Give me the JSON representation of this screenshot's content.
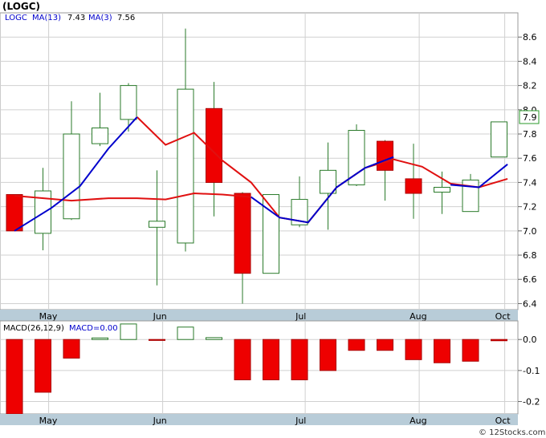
{
  "title": "(LOGC)",
  "watermark": "© 12Stocks.com",
  "chart_data": [
    {
      "type": "candlestick",
      "symbol_label": "LOGC",
      "legend": [
        {
          "label": "MA(13)",
          "value": "7.43",
          "color": "#0000cc"
        },
        {
          "label": "MA(3)",
          "value": "7.56",
          "color": "#0000cc"
        }
      ],
      "last_price_label": "7.9",
      "ylim": [
        6.35,
        8.8
      ],
      "yticks": [
        "6.4",
        "6.6",
        "6.8",
        "7.0",
        "7.2",
        "7.4",
        "7.6",
        "7.8",
        "8.0",
        "8.2",
        "8.4",
        "8.6"
      ],
      "month_labels": [
        {
          "label": "May",
          "index": 1.2
        },
        {
          "label": "Jun",
          "index": 5.2
        },
        {
          "label": "Jul",
          "index": 10.2
        },
        {
          "label": "Aug",
          "index": 14.2
        },
        {
          "label": "Oct",
          "index": 17.2
        }
      ],
      "candles": [
        {
          "open": 7.3,
          "close": 7.0,
          "high": 7.3,
          "low": 7.0,
          "color": "red"
        },
        {
          "open": 6.98,
          "close": 7.33,
          "high": 7.52,
          "low": 6.84,
          "color": "white"
        },
        {
          "open": 7.1,
          "close": 7.8,
          "high": 8.07,
          "low": 7.09,
          "color": "white"
        },
        {
          "open": 7.72,
          "close": 7.85,
          "high": 8.14,
          "low": 7.7,
          "color": "white"
        },
        {
          "open": 7.92,
          "close": 8.2,
          "high": 8.22,
          "low": 7.82,
          "color": "white"
        },
        {
          "open": 7.03,
          "close": 7.08,
          "high": 7.5,
          "low": 6.55,
          "color": "white"
        },
        {
          "open": 6.9,
          "close": 8.17,
          "high": 8.67,
          "low": 6.83,
          "color": "white"
        },
        {
          "open": 8.01,
          "close": 7.4,
          "high": 8.23,
          "low": 7.12,
          "color": "red"
        },
        {
          "open": 7.31,
          "close": 6.65,
          "high": 7.32,
          "low": 6.4,
          "color": "red"
        },
        {
          "open": 6.65,
          "close": 7.3,
          "high": 7.3,
          "low": 6.65,
          "color": "white"
        },
        {
          "open": 7.05,
          "close": 7.26,
          "high": 7.45,
          "low": 7.03,
          "color": "white"
        },
        {
          "open": 7.31,
          "close": 7.5,
          "high": 7.73,
          "low": 7.01,
          "color": "white"
        },
        {
          "open": 7.38,
          "close": 7.83,
          "high": 7.88,
          "low": 7.37,
          "color": "white"
        },
        {
          "open": 7.74,
          "close": 7.5,
          "high": 7.75,
          "low": 7.25,
          "color": "red"
        },
        {
          "open": 7.43,
          "close": 7.31,
          "high": 7.72,
          "low": 7.1,
          "color": "red"
        },
        {
          "open": 7.32,
          "close": 7.36,
          "high": 7.49,
          "low": 7.14,
          "color": "white"
        },
        {
          "open": 7.16,
          "close": 7.42,
          "high": 7.47,
          "low": 7.16,
          "color": "white"
        },
        {
          "open": 7.61,
          "close": 7.9,
          "high": 7.9,
          "low": 7.61,
          "color": "white"
        }
      ],
      "ma_red": [
        {
          "i": 0,
          "v": 7.29
        },
        {
          "i": 2,
          "v": 7.25
        },
        {
          "i": 3.3,
          "v": 7.27
        },
        {
          "i": 4.3,
          "v": 7.27
        },
        {
          "i": 5.3,
          "v": 7.26
        },
        {
          "i": 6.3,
          "v": 7.31
        },
        {
          "i": 7.3,
          "v": 7.3
        },
        {
          "i": 8.3,
          "v": 7.28
        }
      ],
      "ma_red_2": [
        {
          "i": 4.3,
          "v": 7.94
        },
        {
          "i": 5.3,
          "v": 7.71
        },
        {
          "i": 6.3,
          "v": 7.81
        },
        {
          "i": 7.3,
          "v": 7.58
        },
        {
          "i": 8.3,
          "v": 7.4
        },
        {
          "i": 9.3,
          "v": 7.11
        },
        {
          "i": 10.3,
          "v": 7.07
        },
        {
          "i": 11.3,
          "v": 7.36
        },
        {
          "i": 12.3,
          "v": 7.52
        },
        {
          "i": 13.3,
          "v": 7.59
        },
        {
          "i": 14.3,
          "v": 7.53
        },
        {
          "i": 15.3,
          "v": 7.39
        },
        {
          "i": 16.3,
          "v": 7.36
        },
        {
          "i": 17.3,
          "v": 7.43
        }
      ],
      "ma_blue": [
        {
          "i": 0,
          "v": 7.0
        },
        {
          "i": 1.3,
          "v": 7.19
        },
        {
          "i": 2.3,
          "v": 7.37
        },
        {
          "i": 3.3,
          "v": 7.68
        },
        {
          "i": 4.3,
          "v": 7.94
        }
      ],
      "ma_blue_2": [
        {
          "i": 8.3,
          "v": 7.27
        },
        {
          "i": 9.3,
          "v": 7.32
        },
        {
          "i": 10.3,
          "v": 7.36
        },
        {
          "i": 11.3,
          "v": 7.41
        },
        {
          "i": 12.3,
          "v": 7.45
        },
        {
          "i": 13.3,
          "v": 7.5
        },
        {
          "i": 13.6,
          "v": 7.52
        }
      ],
      "ma_blue_3": [
        {
          "i": 8.3,
          "v": 7.28
        },
        {
          "i": 9.3,
          "v": 7.11
        },
        {
          "i": 10.3,
          "v": 7.07
        },
        {
          "i": 11.3,
          "v": 7.36
        },
        {
          "i": 12.3,
          "v": 7.52
        },
        {
          "i": 13.3,
          "v": 7.61
        }
      ],
      "ma_blue_4": [
        {
          "i": 15.3,
          "v": 7.38
        },
        {
          "i": 16.3,
          "v": 7.36
        },
        {
          "i": 17.3,
          "v": 7.55
        }
      ]
    },
    {
      "type": "bar",
      "label": "MACD(26,12,9)",
      "sublabel": "MACD=0.00",
      "ylim": [
        -0.24,
        0.06
      ],
      "yticks": [
        "0.0",
        "-0.1",
        "-0.2"
      ],
      "values": [
        -0.26,
        -0.17,
        -0.06,
        0.005,
        0.05,
        -0.003,
        0.04,
        0.006,
        -0.13,
        -0.13,
        -0.13,
        -0.1,
        -0.035,
        -0.035,
        -0.065,
        -0.075,
        -0.07,
        -0.004
      ],
      "colors": [
        "red",
        "red",
        "red",
        "white",
        "white",
        "red",
        "white",
        "white",
        "red",
        "red",
        "red",
        "red",
        "red",
        "red",
        "red",
        "red",
        "red",
        "red"
      ]
    }
  ]
}
